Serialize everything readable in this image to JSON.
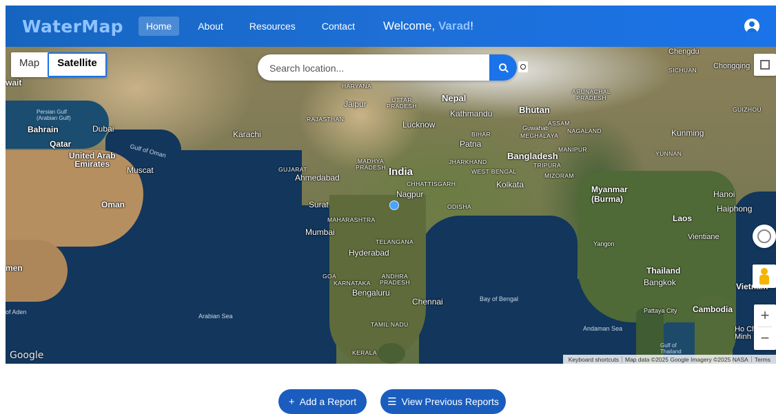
{
  "header": {
    "brand": "WaterMap",
    "nav": [
      {
        "label": "Home",
        "active": true
      },
      {
        "label": "About"
      },
      {
        "label": "Resources"
      },
      {
        "label": "Contact"
      }
    ],
    "welcome_prefix": "Welcome, ",
    "welcome_user": "Varad",
    "welcome_suffix": "!",
    "account_icon": "account-circle-icon"
  },
  "map": {
    "type_options": {
      "map": "Map",
      "satellite": "Satellite"
    },
    "selected_type": "Satellite",
    "search": {
      "placeholder": "Search location..."
    },
    "controls": {
      "zoom_in": "+",
      "zoom_out": "−"
    },
    "google_logo": "Google",
    "attribution": {
      "shortcuts": "Keyboard shortcuts",
      "data": "Map data ©2025 Google Imagery ©2025 NASA",
      "terms": "Terms"
    },
    "labels": {
      "india": "India",
      "nepal": "Nepal",
      "bhutan": "Bhutan",
      "bangladesh": "Bangladesh",
      "myanmar": "Myanmar\n(Burma)",
      "thailand": "Thailand",
      "laos": "Laos",
      "cambodia": "Cambodia",
      "vietnam": "Vietnam",
      "oman": "Oman",
      "uae": "United Arab\nEmirates",
      "qatar": "Qatar",
      "bahrain": "Bahrain",
      "dubai": "Dubai",
      "muscat": "Muscat",
      "karachi": "Karachi",
      "jaipur": "Jaipur",
      "lucknow": "Lucknow",
      "kathmandu": "Kathmandu",
      "patna": "Patna",
      "ahmedabad": "Ahmedabad",
      "surat": "Surat",
      "mumbai": "Mumbai",
      "nagpur": "Nagpur",
      "kolkata": "Kolkata",
      "hyderabad": "Hyderabad",
      "bengaluru": "Bengaluru",
      "chennai": "Chennai",
      "kunming": "Kunming",
      "hanoi": "Hanoi",
      "haiphong": "Haiphong",
      "bangkok": "Bangkok",
      "yangon": "Yangon",
      "vientiane": "Vientiane",
      "chengdu": "Chengdu",
      "chongqing": "Chongqing",
      "guwahati": "Guwahati",
      "pattaya": "Pattaya City",
      "hochiminh": "Ho Chi\nMinh",
      "haryana": "HARYANA",
      "uttar_pradesh": "UTTAR\nPRADESH",
      "rajasthan": "RAJASTHAN",
      "gujarat": "GUJARAT",
      "madhya_pradesh": "MADHYA\nPRADESH",
      "maharashtra": "MAHARASHTRA",
      "telangana": "TELANGANA",
      "andhra": "ANDHRA\nPRADESH",
      "karnataka": "KARNATAKA",
      "tamil_nadu": "TAMIL NADU",
      "kerala": "KERALA",
      "goa": "GOA",
      "odisha": "ODISHA",
      "chhattisgarh": "CHHATTISGARH",
      "jharkhand": "JHARKHAND",
      "west_bengal": "WEST BENGAL",
      "bihar": "BIHAR",
      "assam": "ASSAM",
      "meghalaya": "MEGHALAYA",
      "nagaland": "NAGALAND",
      "manipur": "MANIPUR",
      "mizoram": "MIZORAM",
      "tripura": "TRIPURA",
      "arunachal": "ARUNACHAL\nPRADESH",
      "sichuan": "SICHUAN",
      "yunnan": "YUNNAN",
      "guizhou": "GUIZHOU",
      "arabian_sea": "Arabian Sea",
      "bay_of_bengal": "Bay of Bengal",
      "andaman_sea": "Andaman Sea",
      "gulf_of_oman": "Gulf of Oman",
      "persian_gulf": "Persian Gulf\n(Arabian Gulf)",
      "gulf_of_aden": "of Aden",
      "gulf_thailand": "Gulf of\nThailand",
      "yemen": "men",
      "kuwait": "wait"
    }
  },
  "actions": {
    "add_report": "Add a Report",
    "view_reports": "View Previous Reports"
  }
}
